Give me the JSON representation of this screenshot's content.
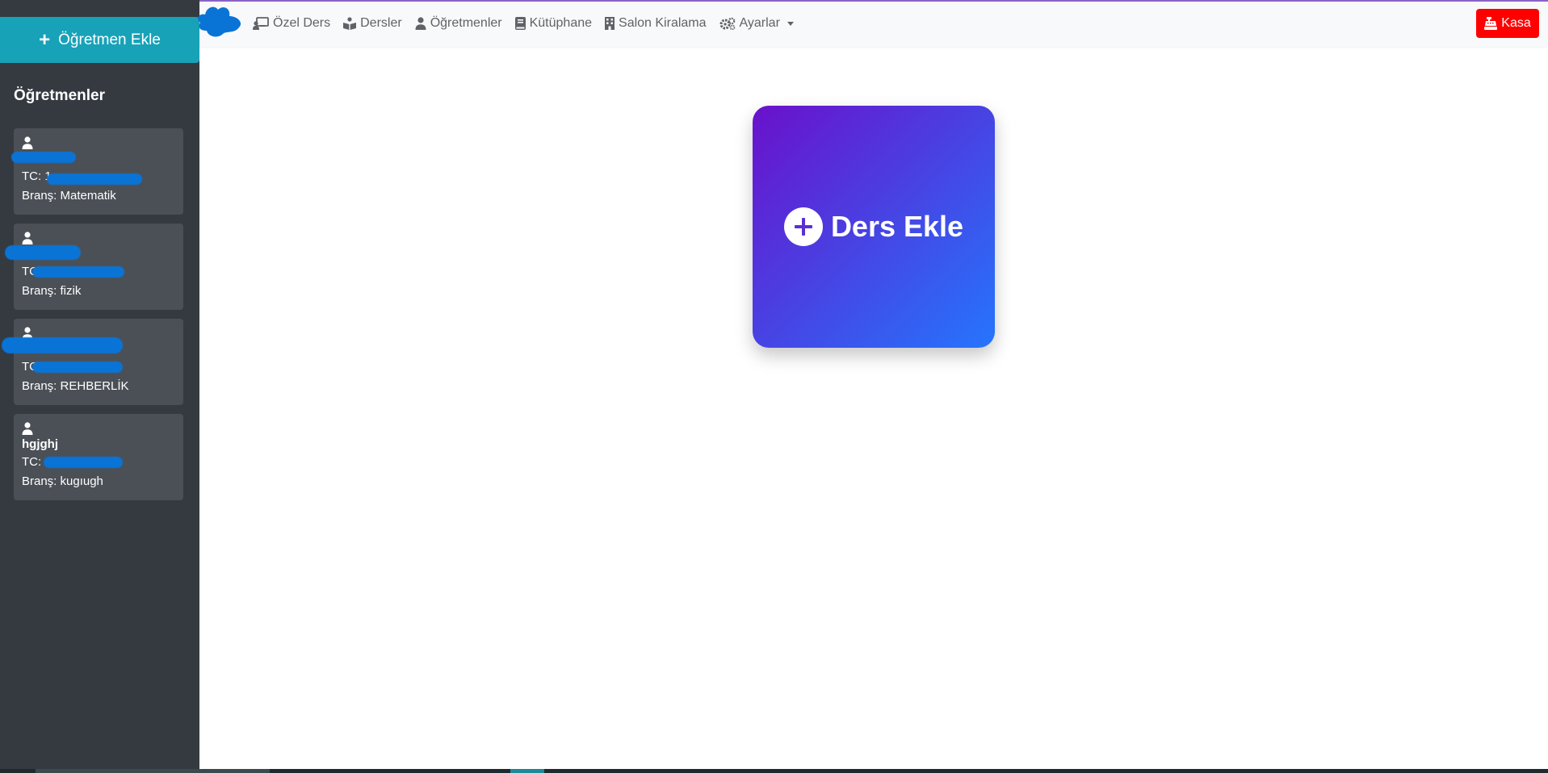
{
  "sidebar": {
    "add_button_label": "Öğretmen Ekle",
    "title": "Öğretmenler",
    "teachers": [
      {
        "name": "",
        "tc": "TC: 1",
        "brans": "Branş: Matematik"
      },
      {
        "name": "",
        "tc": "TC:",
        "brans": "Branş: fizik"
      },
      {
        "name": "",
        "tc": "TC:",
        "brans": "Branş: REHBERLİK"
      },
      {
        "name": "hgjghj",
        "tc": "TC:",
        "brans": "Branş: kugıugh"
      }
    ]
  },
  "nav": {
    "items": [
      {
        "label": "Özel Ders",
        "icon": "chalkboard-teacher-icon"
      },
      {
        "label": "Dersler",
        "icon": "book-reader-icon"
      },
      {
        "label": "Öğretmenler",
        "icon": "user-tie-icon"
      },
      {
        "label": "Kütüphane",
        "icon": "book-icon"
      },
      {
        "label": "Salon Kiralama",
        "icon": "building-icon"
      },
      {
        "label": "Ayarlar",
        "icon": "cogs-icon"
      }
    ],
    "kasa_label": "Kasa"
  },
  "main": {
    "card_label": "Ders Ekle"
  },
  "colors": {
    "sidebar_bg": "#343a40",
    "add_button_bg": "#17a2b8",
    "card_gradient_start": "#6a11cb",
    "card_gradient_end": "#2575fc",
    "kasa_bg": "#ff0000"
  }
}
